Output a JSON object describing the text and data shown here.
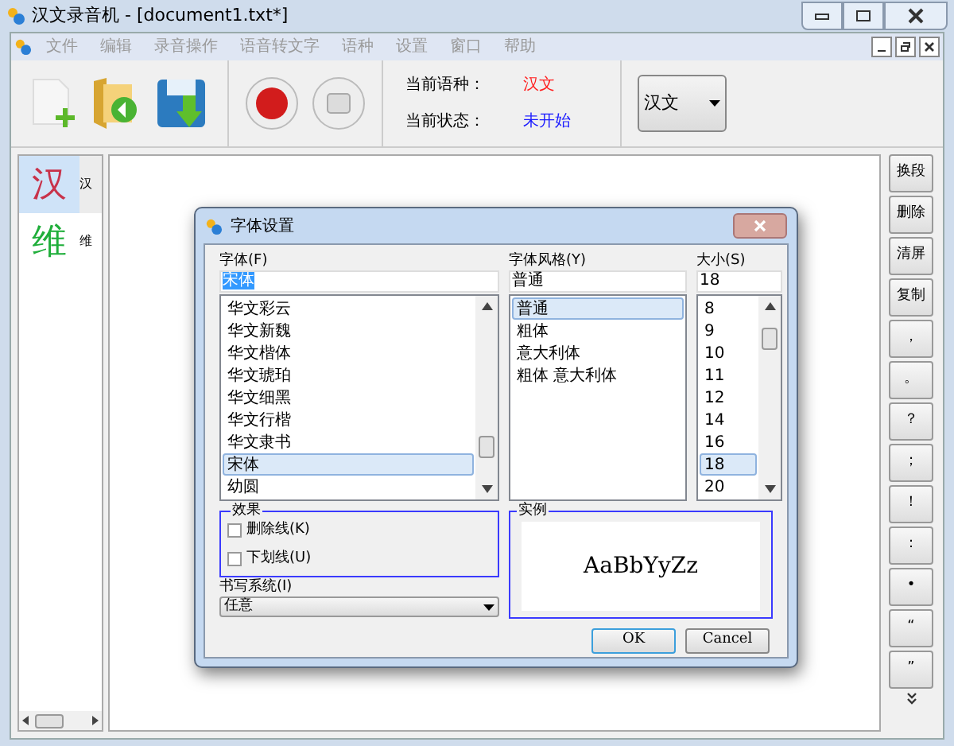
{
  "window": {
    "title": "汉文录音机 - [document1.txt*]"
  },
  "menu": [
    {
      "label": "文件",
      "disabled": true
    },
    {
      "label": "编辑",
      "disabled": true
    },
    {
      "label": "录音操作",
      "disabled": true
    },
    {
      "label": "语音转文字",
      "disabled": true
    },
    {
      "label": "语种",
      "disabled": true
    },
    {
      "label": "设置",
      "disabled": true
    },
    {
      "label": "窗口",
      "disabled": true
    },
    {
      "label": "帮助",
      "disabled": true
    }
  ],
  "status": [
    {
      "label": "当前语种：",
      "value": "汉文",
      "color": "#ff2020"
    },
    {
      "label": "当前状态：",
      "value": "未开始",
      "color": "#1a1aff"
    }
  ],
  "language_select": {
    "value": "汉文"
  },
  "languages": [
    {
      "glyph": "汉",
      "label": "汉",
      "color": "#c8324a",
      "selected": true
    },
    {
      "glyph": "维",
      "label": "维",
      "color": "#1fae3a",
      "selected": false
    }
  ],
  "side_buttons": [
    "换段",
    "删除",
    "清屏",
    "复制",
    "，",
    "。",
    "？",
    "；",
    "！",
    "：",
    "•",
    "“",
    "”"
  ],
  "dialog": {
    "title": "字体设置",
    "font": {
      "label": "字体(F)",
      "value": "宋体",
      "items": [
        {
          "label": "华文彩云",
          "selected": false
        },
        {
          "label": "华文新魏",
          "selected": false
        },
        {
          "label": "华文楷体",
          "selected": false
        },
        {
          "label": "华文琥珀",
          "selected": false
        },
        {
          "label": "华文细黑",
          "selected": false
        },
        {
          "label": "华文行楷",
          "selected": false
        },
        {
          "label": "华文隶书",
          "selected": false
        },
        {
          "label": "宋体",
          "selected": true
        },
        {
          "label": "幼圆",
          "selected": false
        }
      ]
    },
    "style": {
      "label": "字体风格(Y)",
      "value": "普通",
      "items": [
        {
          "label": "普通",
          "selected": true
        },
        {
          "label": "粗体",
          "selected": false
        },
        {
          "label": "意大利体",
          "selected": false
        },
        {
          "label": "粗体 意大利体",
          "selected": false
        }
      ]
    },
    "size": {
      "label": "大小(S)",
      "value": "18",
      "items": [
        {
          "label": "8",
          "selected": false
        },
        {
          "label": "9",
          "selected": false
        },
        {
          "label": "10",
          "selected": false
        },
        {
          "label": "11",
          "selected": false
        },
        {
          "label": "12",
          "selected": false
        },
        {
          "label": "14",
          "selected": false
        },
        {
          "label": "16",
          "selected": false
        },
        {
          "label": "18",
          "selected": true
        },
        {
          "label": "20",
          "selected": false
        }
      ]
    },
    "effects": {
      "title": "效果",
      "options": [
        {
          "label": "删除线(K)",
          "checked": false
        },
        {
          "label": "下划线(U)",
          "checked": false
        }
      ]
    },
    "writing_system": {
      "label": "书写系统(I)",
      "value": "任意"
    },
    "sample": {
      "title": "实例",
      "text": "AaBbYyZz"
    },
    "buttons": [
      "OK",
      "Cancel"
    ]
  }
}
